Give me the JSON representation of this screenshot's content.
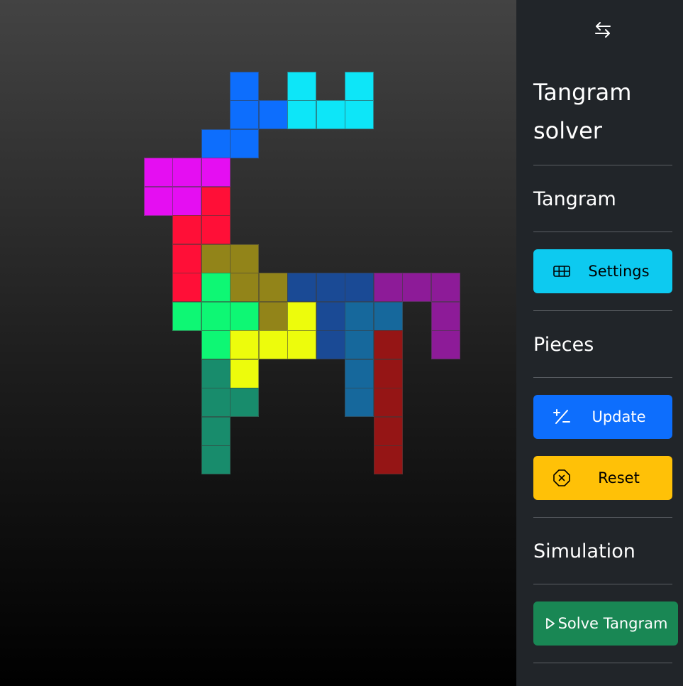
{
  "sidebar": {
    "title": "Tangram solver",
    "toggle_icon": "arrows-left-right-icon",
    "sections": {
      "tangram": "Tangram",
      "pieces": "Pieces",
      "simulation": "Simulation"
    },
    "buttons": {
      "settings": {
        "label": "Settings",
        "icon": "grid-3x2-icon",
        "color": "#0dcaf0"
      },
      "update": {
        "label": "Update",
        "icon": "plus-slash-minus-icon",
        "color": "#0d6efd"
      },
      "reset": {
        "label": "Reset",
        "icon": "x-octagon-icon",
        "color": "#ffc107"
      },
      "solve": {
        "label": "Solve Tangram",
        "icon": "play-icon",
        "color": "#198754"
      }
    }
  },
  "board": {
    "pieces": [
      {
        "name": "blue",
        "color": "#0d6efd",
        "cells": [
          [
            8,
            3
          ],
          [
            8,
            4
          ],
          [
            9,
            4
          ],
          [
            7,
            5
          ],
          [
            8,
            5
          ]
        ]
      },
      {
        "name": "cyan",
        "color": "#0de6f8",
        "cells": [
          [
            10,
            3
          ],
          [
            12,
            3
          ],
          [
            10,
            4
          ],
          [
            11,
            4
          ],
          [
            12,
            4
          ]
        ]
      },
      {
        "name": "magenta",
        "color": "#e50ef2",
        "cells": [
          [
            5,
            6
          ],
          [
            6,
            6
          ],
          [
            7,
            6
          ],
          [
            5,
            7
          ],
          [
            6,
            7
          ]
        ]
      },
      {
        "name": "red",
        "color": "#ff0f37",
        "cells": [
          [
            7,
            7
          ],
          [
            6,
            8
          ],
          [
            7,
            8
          ],
          [
            6,
            9
          ],
          [
            6,
            10
          ]
        ]
      },
      {
        "name": "olive",
        "color": "#928419",
        "cells": [
          [
            7,
            9
          ],
          [
            8,
            9
          ],
          [
            8,
            10
          ],
          [
            9,
            10
          ],
          [
            9,
            11
          ]
        ]
      },
      {
        "name": "green",
        "color": "#0ef774",
        "cells": [
          [
            7,
            10
          ],
          [
            6,
            11
          ],
          [
            7,
            11
          ],
          [
            8,
            11
          ],
          [
            7,
            12
          ]
        ]
      },
      {
        "name": "yellow",
        "color": "#edfc0c",
        "cells": [
          [
            10,
            11
          ],
          [
            8,
            12
          ],
          [
            9,
            12
          ],
          [
            10,
            12
          ],
          [
            8,
            13
          ]
        ]
      },
      {
        "name": "navy",
        "color": "#1a4a95",
        "cells": [
          [
            10,
            10
          ],
          [
            11,
            10
          ],
          [
            12,
            10
          ],
          [
            11,
            11
          ],
          [
            11,
            12
          ]
        ]
      },
      {
        "name": "purple",
        "color": "#8d1b98",
        "cells": [
          [
            13,
            10
          ],
          [
            14,
            10
          ],
          [
            15,
            10
          ],
          [
            15,
            11
          ],
          [
            15,
            12
          ]
        ]
      },
      {
        "name": "steel",
        "color": "#16689c",
        "cells": [
          [
            12,
            11
          ],
          [
            13,
            11
          ],
          [
            12,
            12
          ],
          [
            12,
            13
          ],
          [
            12,
            14
          ]
        ]
      },
      {
        "name": "dark-red",
        "color": "#951515",
        "cells": [
          [
            13,
            12
          ],
          [
            13,
            13
          ],
          [
            13,
            14
          ],
          [
            13,
            15
          ],
          [
            13,
            16
          ]
        ]
      },
      {
        "name": "teal",
        "color": "#188c6c",
        "cells": [
          [
            7,
            13
          ],
          [
            7,
            14
          ],
          [
            8,
            14
          ],
          [
            7,
            15
          ],
          [
            7,
            16
          ]
        ]
      }
    ]
  }
}
